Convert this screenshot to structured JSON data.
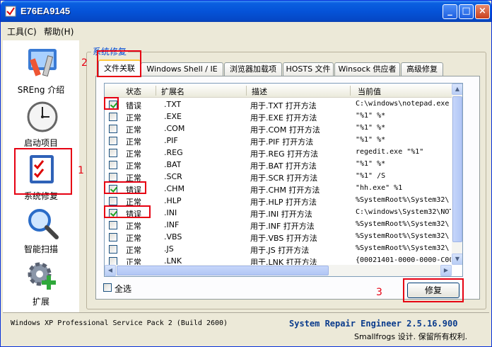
{
  "window": {
    "title": "E76EA9145",
    "minimize": "_",
    "maximize": "□",
    "close": "×"
  },
  "menu": {
    "tools": "工具(C)",
    "help": "帮助(H)"
  },
  "sidebar": {
    "items": [
      {
        "label": "SREng 介绍",
        "icon": "tools-icon"
      },
      {
        "label": "启动项目",
        "icon": "clock-icon"
      },
      {
        "label": "系统修复",
        "icon": "checklist-icon"
      },
      {
        "label": "智能扫描",
        "icon": "magnifier-icon"
      },
      {
        "label": "扩展",
        "icon": "gear-plus-icon"
      }
    ]
  },
  "group": {
    "title": "系统修复"
  },
  "tabs": [
    {
      "label": "文件关联",
      "active": true
    },
    {
      "label": "Windows Shell / IE",
      "active": false
    },
    {
      "label": "浏览器加载项",
      "active": false
    },
    {
      "label": "HOSTS 文件",
      "active": false
    },
    {
      "label": "Winsock 供应者",
      "active": false
    },
    {
      "label": "高级修复",
      "active": false
    }
  ],
  "table": {
    "headers": [
      "状态",
      "扩展名",
      "描述",
      "当前值"
    ],
    "rows": [
      {
        "checked": true,
        "status": "错误",
        "ext": ".TXT",
        "desc": "用于.TXT 打开方法",
        "value": "C:\\windows\\notepad.exe"
      },
      {
        "checked": false,
        "status": "正常",
        "ext": ".EXE",
        "desc": "用于.EXE 打开方法",
        "value": "\"%1\" %*"
      },
      {
        "checked": false,
        "status": "正常",
        "ext": ".COM",
        "desc": "用于.COM 打开方法",
        "value": "\"%1\" %*"
      },
      {
        "checked": false,
        "status": "正常",
        "ext": ".PIF",
        "desc": "用于.PIF 打开方法",
        "value": "\"%1\" %*"
      },
      {
        "checked": false,
        "status": "正常",
        "ext": ".REG",
        "desc": "用于.REG 打开方法",
        "value": "regedit.exe \"%1\""
      },
      {
        "checked": false,
        "status": "正常",
        "ext": ".BAT",
        "desc": "用于.BAT 打开方法",
        "value": "\"%1\" %*"
      },
      {
        "checked": false,
        "status": "正常",
        "ext": ".SCR",
        "desc": "用于.SCR 打开方法",
        "value": "\"%1\" /S"
      },
      {
        "checked": true,
        "status": "错误",
        "ext": ".CHM",
        "desc": "用于.CHM 打开方法",
        "value": "\"hh.exe\" %1"
      },
      {
        "checked": false,
        "status": "正常",
        "ext": ".HLP",
        "desc": "用于.HLP 打开方法",
        "value": "%SystemRoot%\\System32\\"
      },
      {
        "checked": true,
        "status": "错误",
        "ext": ".INI",
        "desc": "用于.INI 打开方法",
        "value": "C:\\windows\\System32\\NOT"
      },
      {
        "checked": false,
        "status": "正常",
        "ext": ".INF",
        "desc": "用于.INF 打开方法",
        "value": "%SystemRoot%\\System32\\"
      },
      {
        "checked": false,
        "status": "正常",
        "ext": ".VBS",
        "desc": "用于.VBS 打开方法",
        "value": "%SystemRoot%\\System32\\"
      },
      {
        "checked": false,
        "status": "正常",
        "ext": ".JS",
        "desc": "用于.JS 打开方法",
        "value": "%SystemRoot%\\System32\\"
      },
      {
        "checked": false,
        "status": "正常",
        "ext": ".LNK",
        "desc": "用于.LNK 打开方法",
        "value": "{00021401-0000-0000-C00"
      }
    ]
  },
  "select_all": {
    "label": "全选",
    "checked": false
  },
  "repair_button": "修复",
  "status": {
    "os": "Windows XP Professional Service Pack 2 (Build 2600)",
    "brand": "System Repair Engineer 2.5.16.900",
    "credit": "Smallfrogs 设计. 保留所有权利."
  },
  "annotations": [
    "1",
    "2",
    "3"
  ],
  "colors": {
    "title_bar": "#0553d8",
    "annotation": "#e60012",
    "group_title": "#0046d5",
    "brand_text": "#0a3b8c"
  }
}
